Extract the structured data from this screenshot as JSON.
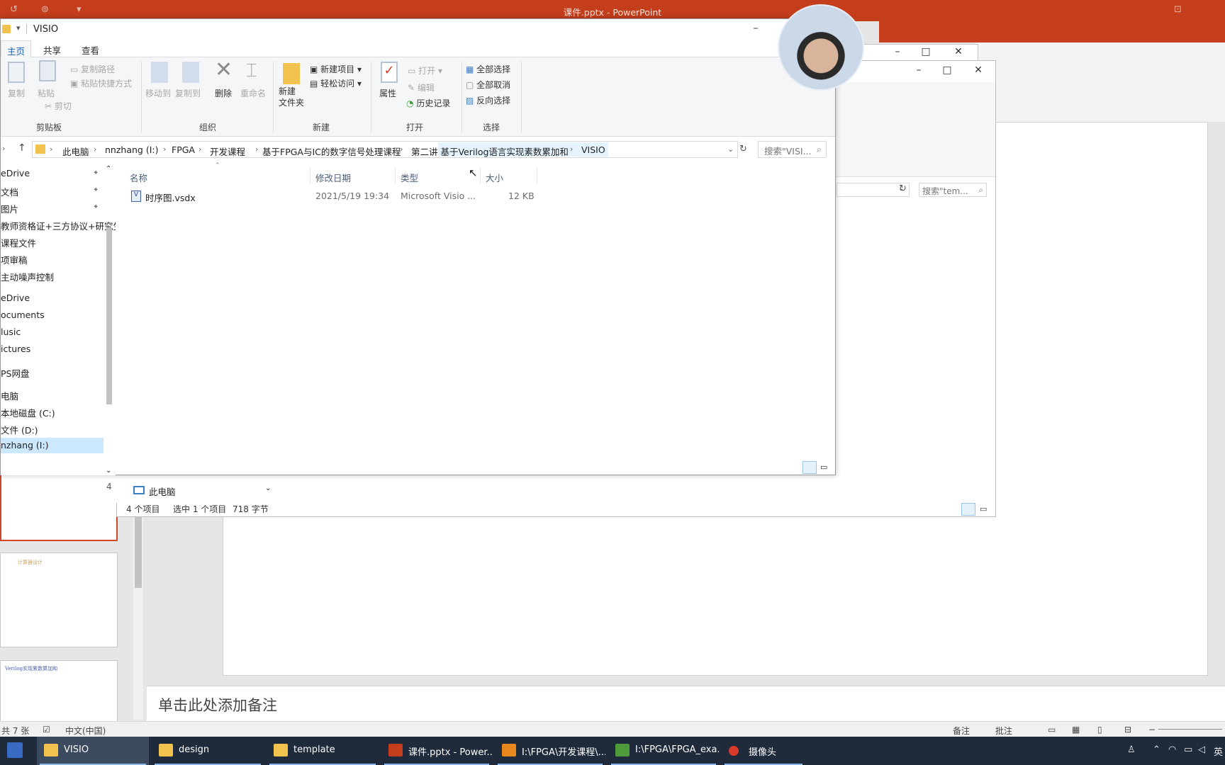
{
  "powerpoint": {
    "title": "课件.pptx - PowerPoint",
    "notes_placeholder": "单击此处添加备注",
    "status": {
      "slide_count": "共 7 张",
      "language": "中文(中国)",
      "notes": "备注",
      "comments": "批注"
    },
    "thumbnail_number": "4",
    "thumb_text_1": "计算器设计",
    "thumb_text_2": "Verilog实现累数算加和"
  },
  "explorer_main": {
    "title": "VISIO",
    "tabs": [
      "主页",
      "共享",
      "查看"
    ],
    "ribbon": {
      "clipboard": {
        "copy": "复制",
        "paste": "粘贴",
        "copy_path": "复制路径",
        "paste_shortcut": "粘贴快捷方式",
        "cut": "剪切",
        "label": "剪贴板"
      },
      "organize": {
        "move_to": "移动到",
        "copy_to": "复制到",
        "delete": "删除",
        "rename": "重命名",
        "label": "组织"
      },
      "new": {
        "new_folder": "新建\n文件夹",
        "new_item": "新建项目",
        "easy_access": "轻松访问",
        "label": "新建"
      },
      "open": {
        "properties": "属性",
        "open": "打开",
        "edit": "编辑",
        "history": "历史记录",
        "label": "打开"
      },
      "select": {
        "select_all": "全部选择",
        "select_none": "全部取消",
        "invert": "反向选择",
        "label": "选择"
      }
    },
    "breadcrumb": [
      "此电脑",
      "nnzhang (I:)",
      "FPGA",
      "开发课程",
      "基于FPGA与IC的数字信号处理课程",
      "第二讲 基于Verilog语言实现素数累加和",
      "VISIO"
    ],
    "search_placeholder": "搜索\"VISI...",
    "nav": [
      "eDrive",
      "文档",
      "图片",
      "教师资格证+三方协议+研究生",
      "课程文件",
      "项审稿",
      "主动噪声控制",
      "eDrive",
      "ocuments",
      "lusic",
      "ictures",
      "PS网盘",
      "电脑",
      "本地磁盘 (C:)",
      "文件 (D:)",
      "nzhang (I:)"
    ],
    "columns": [
      "名称",
      "修改日期",
      "类型",
      "大小"
    ],
    "files": [
      {
        "name": "时序图.vsdx",
        "modified": "2021/5/19 19:34",
        "type": "Microsoft Visio ...",
        "size": "12 KB"
      }
    ]
  },
  "explorer_second": {
    "search_placeholder": "搜索\"tem...",
    "nav_item": "此电脑",
    "status_items": "4 个项目",
    "status_selected": "选中 1 个项目",
    "status_size": "718 字节"
  },
  "taskbar": {
    "tasks": [
      "VISIO",
      "design",
      "template",
      "课件.pptx - Power...",
      "I:\\FPGA\\开发课程\\...",
      "I:\\FPGA\\FPGA_exa...",
      "摄像头"
    ],
    "tray_lang": "英"
  },
  "colors": {
    "ppt_red": "#c43e1c",
    "selection_blue": "#cce8ff",
    "taskbar": "#1f2a3a"
  }
}
